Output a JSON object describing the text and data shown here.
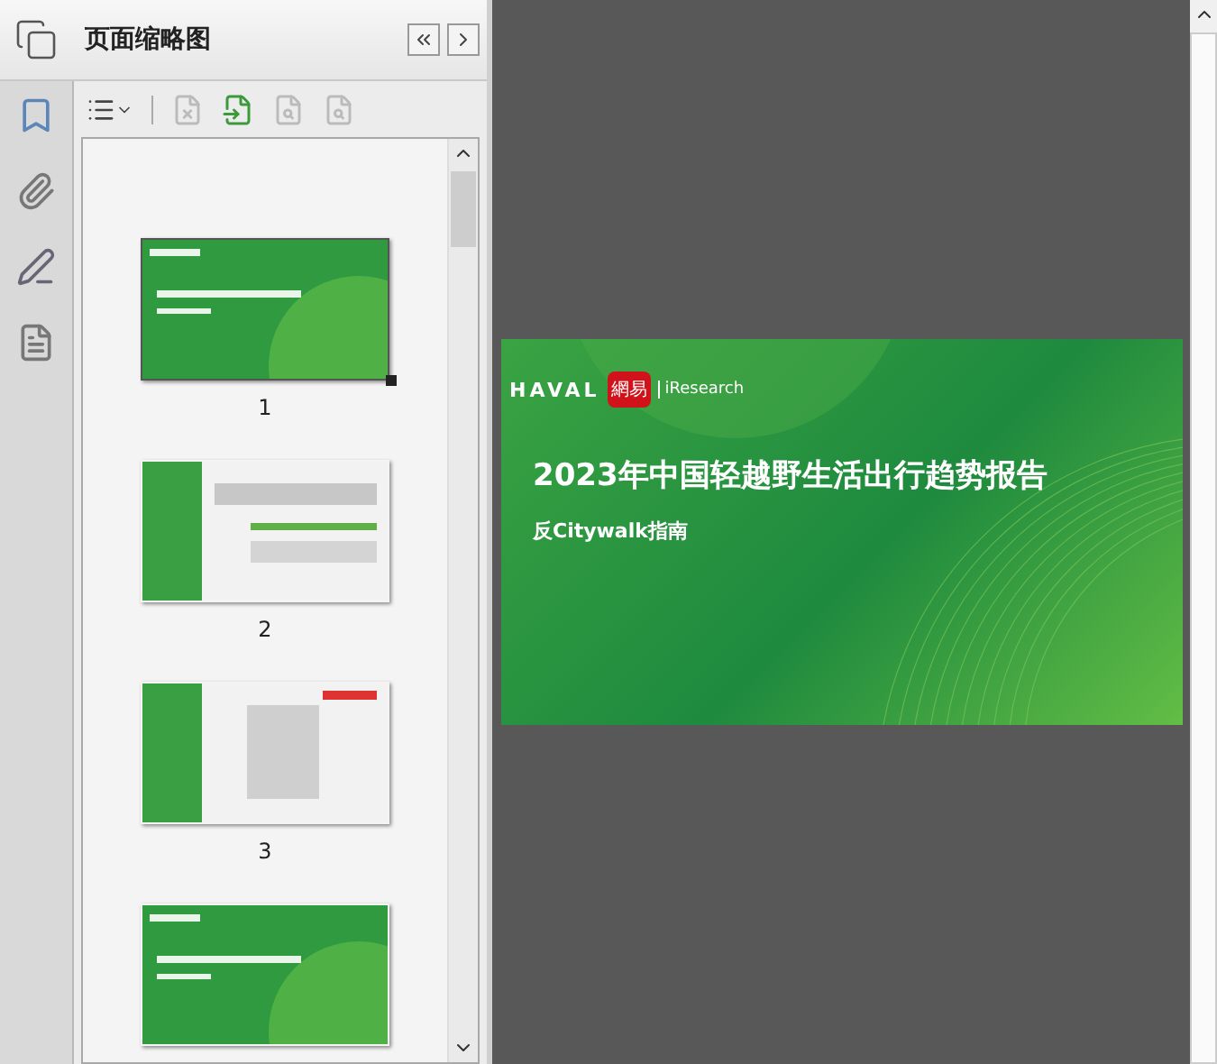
{
  "panel": {
    "title": "页面缩略图"
  },
  "thumbnails": [
    {
      "kind": "cover",
      "label": "1",
      "selected": true
    },
    {
      "kind": "text",
      "label": "2",
      "selected": false
    },
    {
      "kind": "contents",
      "label": "3",
      "selected": false
    },
    {
      "kind": "cover",
      "selected": false
    }
  ],
  "page": {
    "brand": "HAVAL",
    "badge": "網易",
    "partner": "iResearch",
    "title": "2023年中国轻越野生活出行趋势报告",
    "subtitle": "反Citywalk指南"
  }
}
